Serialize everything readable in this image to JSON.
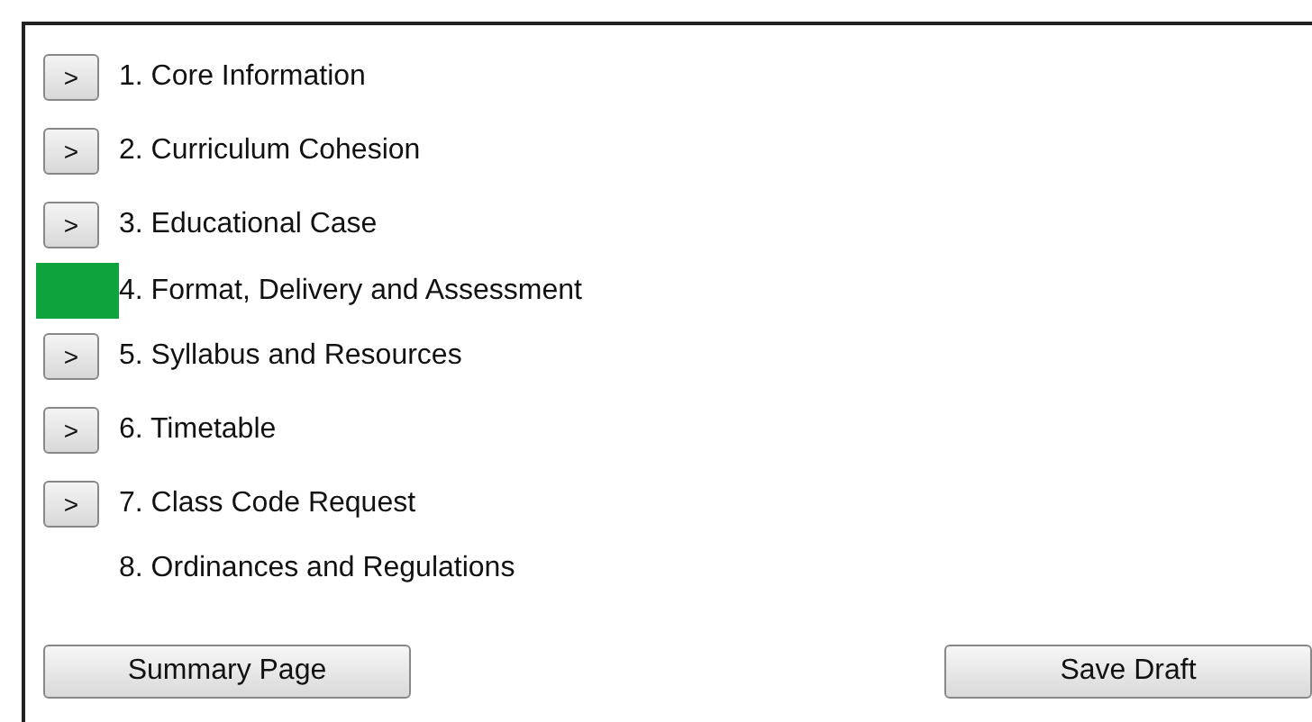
{
  "sections": [
    {
      "kind": "expand",
      "button": ">",
      "label": "1. Core Information"
    },
    {
      "kind": "expand",
      "button": ">",
      "label": "2. Curriculum Cohesion"
    },
    {
      "kind": "expand",
      "button": ">",
      "label": "3. Educational Case"
    },
    {
      "kind": "complete",
      "color": "#0ea33d",
      "label": "4. Format, Delivery and Assessment"
    },
    {
      "kind": "expand",
      "button": ">",
      "label": "5. Syllabus and Resources"
    },
    {
      "kind": "expand",
      "button": ">",
      "label": "6. Timetable"
    },
    {
      "kind": "expand",
      "button": ">",
      "label": "7. Class Code Request"
    },
    {
      "kind": "plain",
      "label": "8. Ordinances and Regulations"
    }
  ],
  "buttons": [
    "Summary Page",
    "Save Draft"
  ]
}
